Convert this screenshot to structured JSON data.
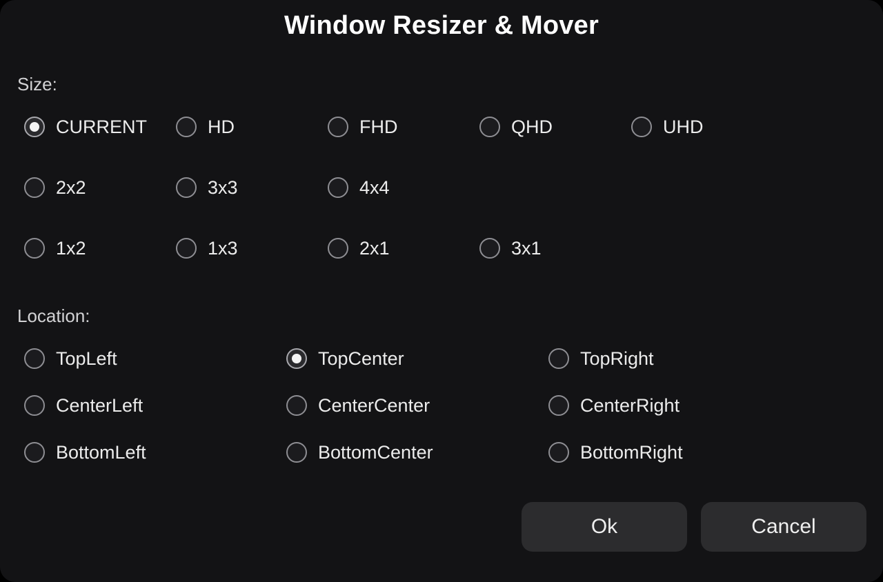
{
  "dialog": {
    "title": "Window Resizer & Mover"
  },
  "size": {
    "label": "Size:",
    "selected": "CURRENT",
    "options": [
      "CURRENT",
      "HD",
      "FHD",
      "QHD",
      "UHD",
      "2x2",
      "3x3",
      "4x4",
      "1x2",
      "1x3",
      "2x1",
      "3x1"
    ]
  },
  "location": {
    "label": "Location:",
    "selected": "TopCenter",
    "options": [
      "TopLeft",
      "TopCenter",
      "TopRight",
      "CenterLeft",
      "CenterCenter",
      "CenterRight",
      "BottomLeft",
      "BottomCenter",
      "BottomRight"
    ]
  },
  "buttons": {
    "ok": "Ok",
    "cancel": "Cancel"
  }
}
